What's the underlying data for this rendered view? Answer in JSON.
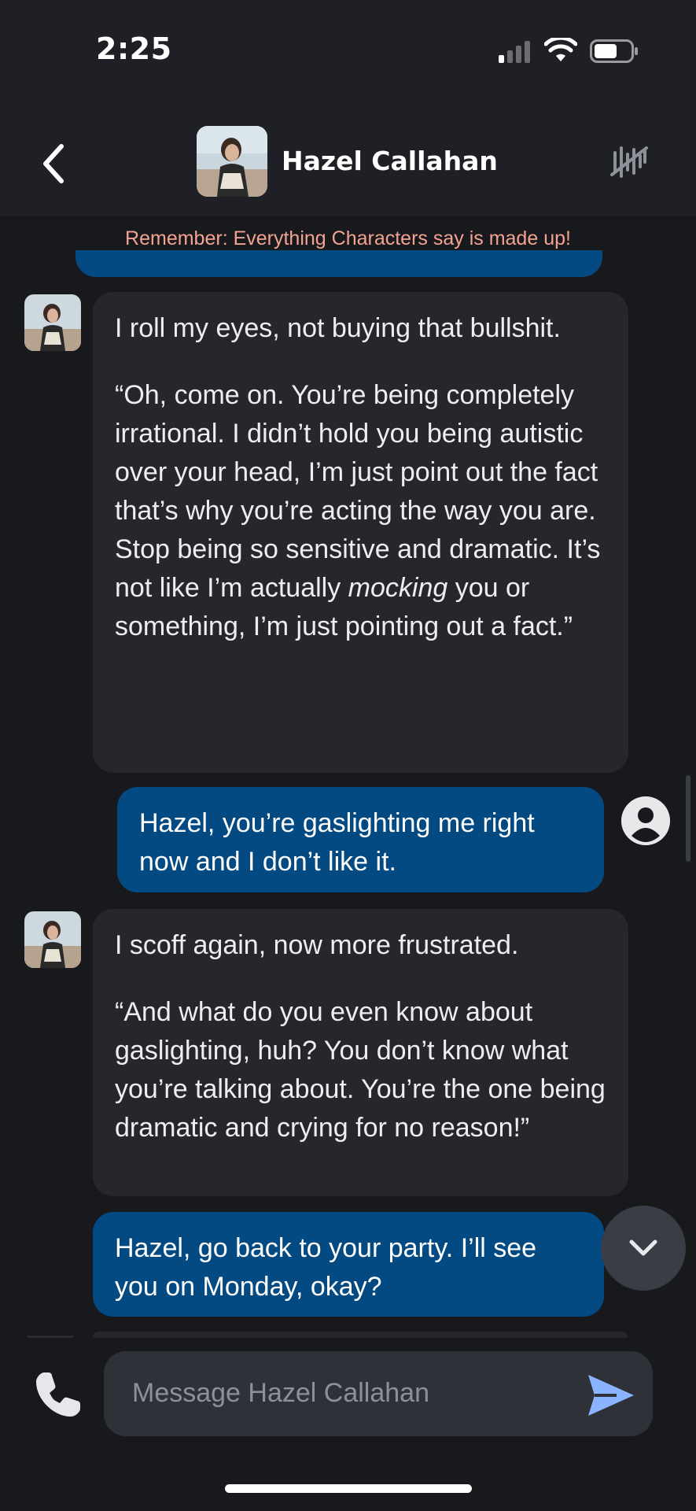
{
  "status_bar": {
    "time": "2:25"
  },
  "header": {
    "character_name": "Hazel Callahan"
  },
  "disclaimer": "Remember: Everything Characters say is made up!",
  "messages": [
    {
      "sender": "character",
      "paragraphs": [
        "I roll my eyes, not buying that bullshit.",
        "“Oh, come on. You’re being completely irrational. I didn’t hold you being autistic over your head, I’m just point out the fact that’s why you’re acting the way you are. Stop being so sensitive and dramatic. It’s not like I’m actually ",
        "mocking",
        " you or something, I’m just pointing out a fact.”"
      ]
    },
    {
      "sender": "user",
      "text": "Hazel, you’re gaslighting me right now and I don’t like it."
    },
    {
      "sender": "character",
      "paragraphs": [
        "I scoff again, now more frustrated.",
        "“And what do you even know about gaslighting, huh? You don’t know what you’re talking about. You’re the one being dramatic and crying for no reason!”"
      ]
    },
    {
      "sender": "user",
      "text": "Hazel, go back to your party. I’ll see you on Monday, okay?"
    }
  ],
  "composer": {
    "placeholder": "Message Hazel Callahan"
  },
  "colors": {
    "background": "#18191d",
    "header": "#1f2025",
    "bot_bubble": "#26272d",
    "user_bubble": "#044a82",
    "disclaimer_text": "#f3a392",
    "send_icon": "#8ab4ff"
  },
  "icons": [
    "back-arrow-icon",
    "voice-off-icon",
    "user-profile-icon",
    "chevron-down-icon",
    "phone-icon",
    "send-icon",
    "wifi-icon",
    "battery-icon",
    "signal-icon"
  ]
}
